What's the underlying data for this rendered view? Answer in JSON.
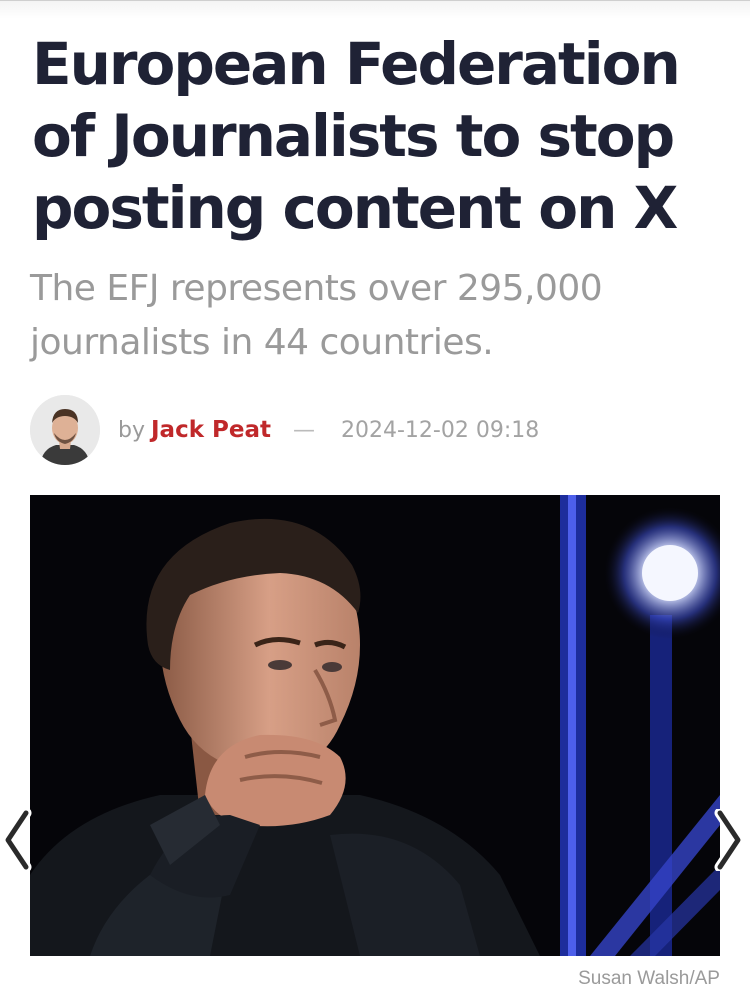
{
  "article": {
    "headline": "European Federation of Journalists to stop posting content on X",
    "subtitle": "The EFJ represents over 295,000 journalists in 44 countries."
  },
  "byline": {
    "prefix": "by",
    "author": "Jack Peat",
    "separator": "—",
    "timestamp": "2024-12-02 09:18"
  },
  "gallery": {
    "prev_icon": "chevron-left-icon",
    "next_icon": "chevron-right-icon",
    "caption": "Susan Walsh/AP"
  },
  "colors": {
    "headline": "#1f2235",
    "author": "#c0282a",
    "muted": "#9a9a9a"
  }
}
